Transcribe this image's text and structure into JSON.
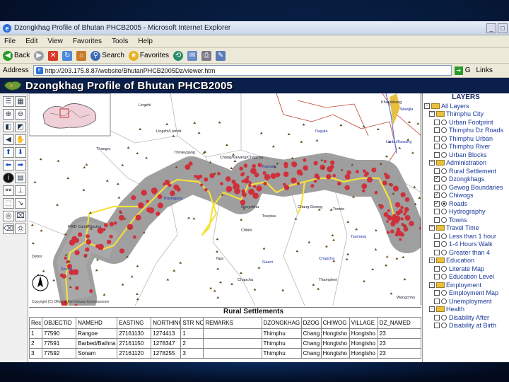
{
  "window": {
    "title": "Dzongkhag Profile of Bhutan PHCB2005 - Microsoft Internet Explorer"
  },
  "menu": [
    "File",
    "Edit",
    "View",
    "Favorites",
    "Tools",
    "Help"
  ],
  "toolbar": {
    "back_label": "Back",
    "search_label": "Search",
    "favorites_label": "Favorites"
  },
  "address": {
    "label": "Address",
    "url": "http://203.175.8.87/website/BhutanPHCB2005Dz/viewer.htm",
    "go_label": "G",
    "links_label": "Links"
  },
  "app": {
    "title": "Dzongkhag Profile of Bhutan PHCB2005"
  },
  "map": {
    "place_labels": [
      {
        "text": "Lingzhi",
        "color": "#223"
      },
      {
        "text": "Khatekhang",
        "color": "#223"
      },
      {
        "text": "Wangla",
        "color": "#2233aa"
      },
      {
        "text": "Lingzhi/Lomdir",
        "color": "#223"
      },
      {
        "text": "Thangro",
        "color": "#223"
      },
      {
        "text": "Thinleygang",
        "color": "#223"
      },
      {
        "text": "Chang/Kawang/Chapcha",
        "color": "#223"
      },
      {
        "text": "Kawang",
        "color": "#2233aa"
      },
      {
        "text": "Limbu/Kawang",
        "color": "#2233aa"
      },
      {
        "text": "Dagala",
        "color": "#2233aa"
      },
      {
        "text": "Trashigang",
        "color": "#2233aa"
      },
      {
        "text": "Chhilo",
        "color": "#223"
      },
      {
        "text": "Genyekha",
        "color": "#223"
      },
      {
        "text": "Chang Gewog",
        "color": "#223"
      },
      {
        "text": "Tsento",
        "color": "#223"
      },
      {
        "text": "Toepisa",
        "color": "#223"
      },
      {
        "text": "Chapcha",
        "color": "#223"
      },
      {
        "text": "FWD Camp Doctos",
        "color": "#223"
      },
      {
        "text": "Debsi",
        "color": "#223"
      },
      {
        "text": "Soena",
        "color": "#2233aa"
      },
      {
        "text": "Nga",
        "color": "#223"
      },
      {
        "text": "Thampheri",
        "color": "#223"
      },
      {
        "text": "Gaarri",
        "color": "#2233aa"
      },
      {
        "text": "Chapcha",
        "color": "#2233aa"
      },
      {
        "text": "Tsamang",
        "color": "#2233aa"
      },
      {
        "text": "Wangchhu",
        "color": "#223"
      }
    ],
    "copyright": "Copyright (C) Office of the Census Commissioner"
  },
  "layers": {
    "title": "LAYERS",
    "rows": [
      {
        "kind": "group",
        "label": "All Layers",
        "indent": 0
      },
      {
        "kind": "group",
        "label": "Thimphu City",
        "indent": 1
      },
      {
        "kind": "layer",
        "label": "Urban Footprint",
        "indent": 2,
        "checked": false,
        "active": false
      },
      {
        "kind": "layer",
        "label": "Thimphu Dz Roads",
        "indent": 2,
        "checked": false,
        "active": false
      },
      {
        "kind": "layer",
        "label": "Thimphu Urban",
        "indent": 2,
        "checked": false,
        "active": false
      },
      {
        "kind": "layer",
        "label": "Thimphu River",
        "indent": 2,
        "checked": false,
        "active": false
      },
      {
        "kind": "layer",
        "label": "Urban Blocks",
        "indent": 2,
        "checked": false,
        "active": false
      },
      {
        "kind": "group",
        "label": "Administration",
        "indent": 1
      },
      {
        "kind": "layer",
        "label": "Rural Settlement",
        "indent": 2,
        "checked": false,
        "active": false
      },
      {
        "kind": "layer",
        "label": "Dzongkhags",
        "indent": 2,
        "checked": true,
        "active": false
      },
      {
        "kind": "layer",
        "label": "Gewog Boundaries",
        "indent": 2,
        "checked": false,
        "active": false
      },
      {
        "kind": "layer",
        "label": "Chiwogs",
        "indent": 2,
        "checked": true,
        "active": false
      },
      {
        "kind": "layer",
        "label": "Roads",
        "indent": 2,
        "checked": true,
        "active": true
      },
      {
        "kind": "layer",
        "label": "Hydrography",
        "indent": 2,
        "checked": false,
        "active": false
      },
      {
        "kind": "layer",
        "label": "Towns",
        "indent": 2,
        "checked": false,
        "active": false
      },
      {
        "kind": "group",
        "label": "Travel Time",
        "indent": 1
      },
      {
        "kind": "layer",
        "label": "Less than 1 hour",
        "indent": 2,
        "checked": false,
        "active": false
      },
      {
        "kind": "layer",
        "label": "1-4 Hours Walk",
        "indent": 2,
        "checked": false,
        "active": false
      },
      {
        "kind": "layer",
        "label": "Greater than 4",
        "indent": 2,
        "checked": false,
        "active": false
      },
      {
        "kind": "group",
        "label": "Education",
        "indent": 1
      },
      {
        "kind": "layer",
        "label": "Literate Map",
        "indent": 2,
        "checked": false,
        "active": false
      },
      {
        "kind": "layer",
        "label": "Education Level",
        "indent": 2,
        "checked": false,
        "active": false
      },
      {
        "kind": "group",
        "label": "Employment",
        "indent": 1
      },
      {
        "kind": "layer",
        "label": "Employment Map",
        "indent": 2,
        "checked": false,
        "active": false
      },
      {
        "kind": "layer",
        "label": "Unemployment",
        "indent": 2,
        "checked": false,
        "active": false
      },
      {
        "kind": "group",
        "label": "Health",
        "indent": 1
      },
      {
        "kind": "layer",
        "label": "Disability After",
        "indent": 2,
        "checked": false,
        "active": false
      },
      {
        "kind": "layer",
        "label": "Disability at Birth",
        "indent": 2,
        "checked": false,
        "active": false
      }
    ]
  },
  "table": {
    "caption": "Rural Settlements",
    "columns": [
      "Rec",
      "OBJECTID",
      "NAMEHD",
      "EASTING",
      "NORTHING",
      "STR NO",
      "REMARKS",
      "DZONGKHAG",
      "DZOG",
      "CHIWOG",
      "VILLAGE",
      "DZ_NAMED"
    ],
    "rows": [
      [
        "1",
        "77590",
        "Rangoe",
        "27161130",
        "1274413",
        "1",
        "",
        "Thimphu",
        "Chang",
        "Hongtsho",
        "Hongtsho",
        "23"
      ],
      [
        "2",
        "77591",
        "Barbed/Bathna",
        "27161150",
        "1278347",
        "2",
        "",
        "Thimphu",
        "Chang",
        "Hongtsho",
        "Hongtsho",
        "23"
      ],
      [
        "3",
        "77592",
        "Sonam",
        "27161120",
        "1278255",
        "3",
        "",
        "Thimphu",
        "Chang",
        "Hongtsho",
        "Hongtsho",
        "23"
      ]
    ]
  },
  "colors": {
    "title_bg": "#0a1f4a",
    "road": "#f5e03a",
    "buffer": "#9a9a9a",
    "settlement": "#d0303c",
    "river": "#5a7ad8"
  }
}
